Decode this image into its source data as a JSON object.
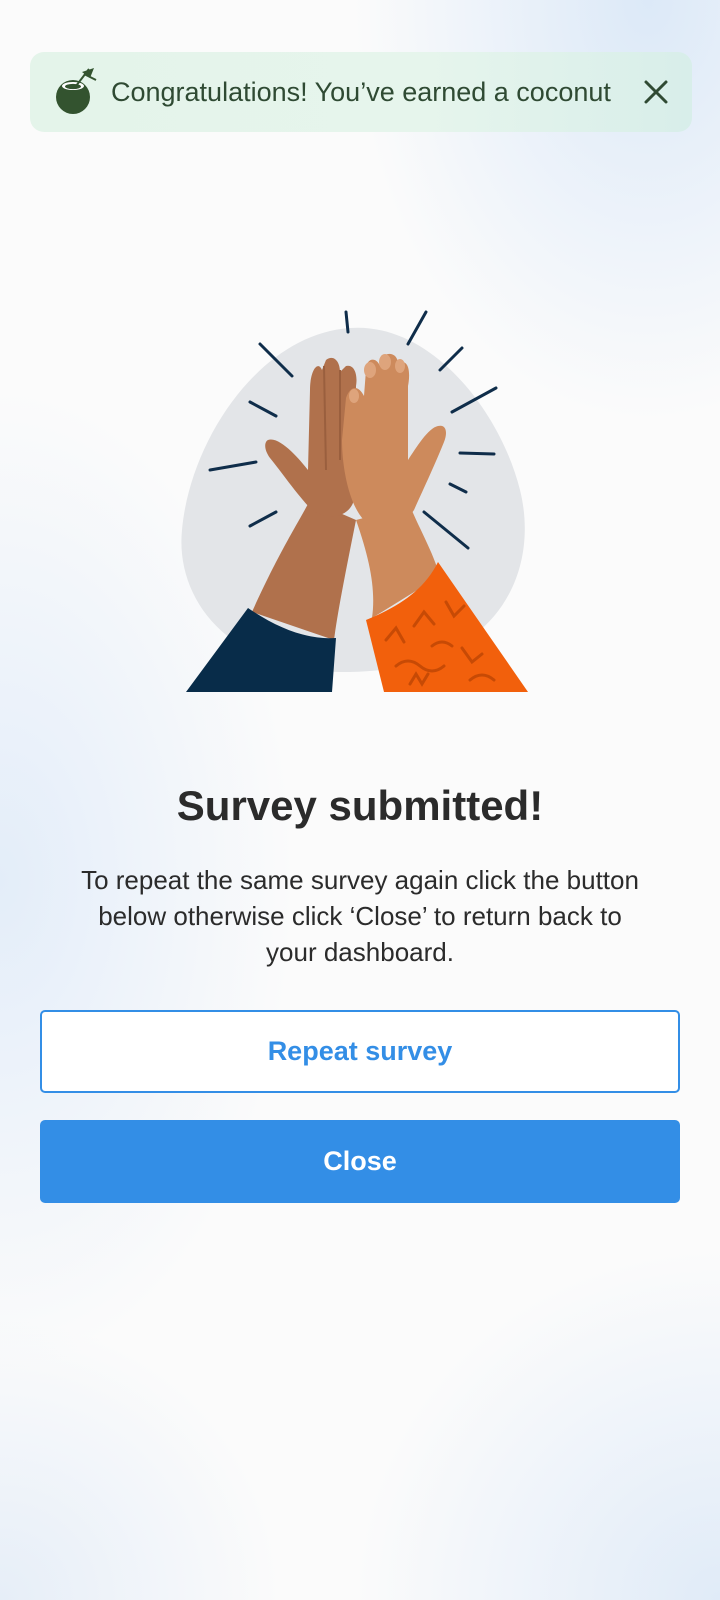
{
  "toast": {
    "message": "Congratulations! You’ve earned a coconut",
    "icon": "coconut-icon",
    "close_icon": "close-icon",
    "text_color": "#2f4a33",
    "background": "#e4f4ea"
  },
  "illustration": {
    "icon": "high-five-illustration"
  },
  "main": {
    "title": "Survey submitted!",
    "description": "To repeat the same survey again click the button below otherwise click ‘Close’ to return back to your dashboard."
  },
  "actions": {
    "repeat_label": "Repeat survey",
    "close_label": "Close",
    "accent_color": "#338ee6"
  }
}
